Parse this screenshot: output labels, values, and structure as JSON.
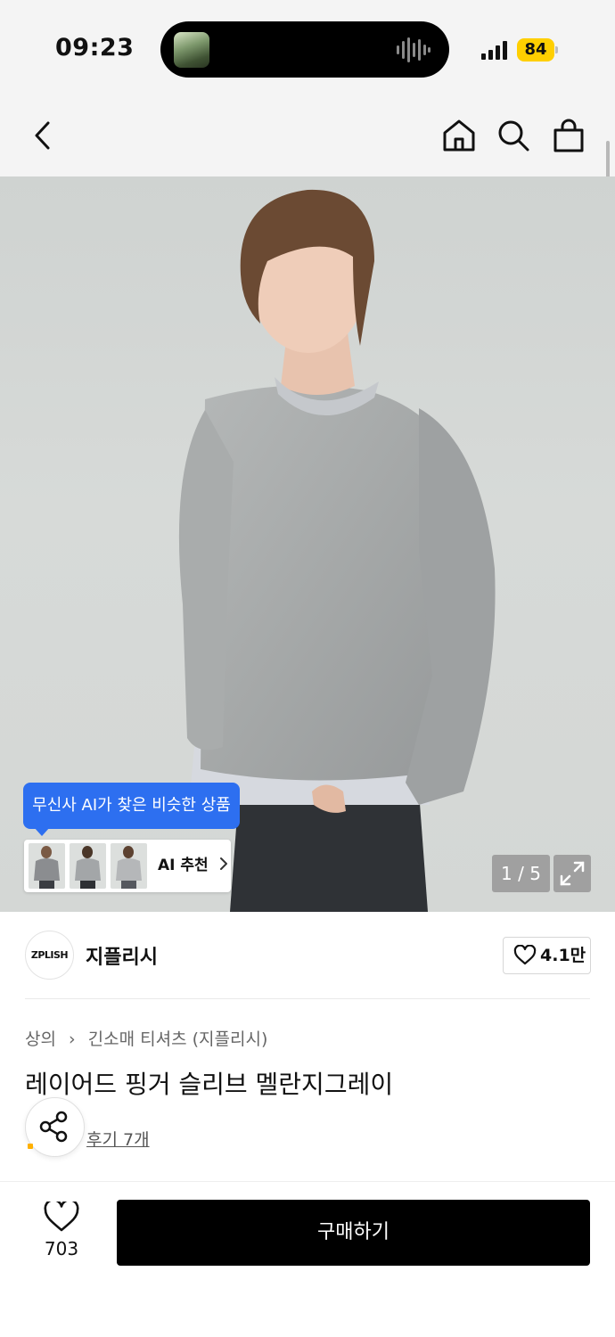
{
  "status_bar": {
    "time": "09:23",
    "battery": "84"
  },
  "colors": {
    "accent_blue": "#2d6ff0",
    "battery_yellow": "#ffcf00",
    "buy_button": "#000000"
  },
  "nav": {
    "back_icon": "chevron-left-icon",
    "home_icon": "home-icon",
    "search_icon": "search-icon",
    "cart_icon": "shopping-bag-icon"
  },
  "gallery": {
    "ai_recommend_tooltip": "무신사 AI가 찾은 비슷한 상품",
    "ai_recommend_label": "AI 추천",
    "page_indicator": "1 / 5",
    "expand_icon": "expand-icon"
  },
  "brand": {
    "logo_text": "ZPLISH",
    "name": "지플리시",
    "likes": "4.1만"
  },
  "product": {
    "breadcrumb": [
      "상의",
      "긴소매 티셔츠 (지플리시)"
    ],
    "title": "레이어드 핑거 슬리브 멜란지그레이",
    "reviews": "후기 7개"
  },
  "bottom_bar": {
    "like_count": "703",
    "buy_label": "구매하기"
  }
}
